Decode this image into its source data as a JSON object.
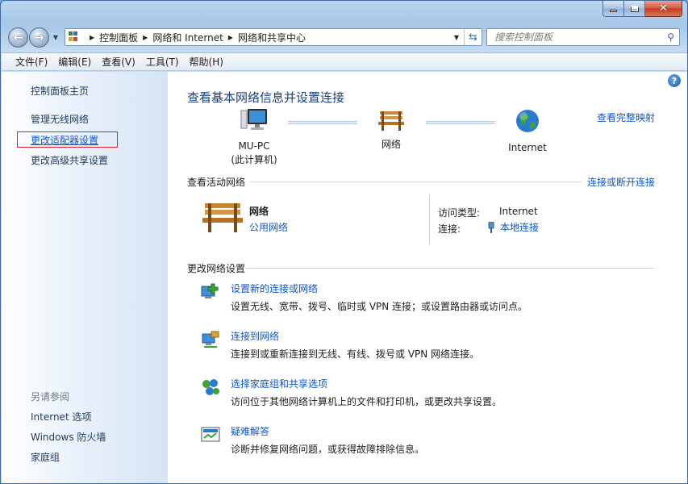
{
  "window": {
    "caption": {
      "minimize": "—",
      "maximize": "□",
      "close": "✕"
    }
  },
  "nav": {
    "back_icon": "back-arrow-icon",
    "forward_icon": "forward-arrow-icon",
    "breadcrumbs": [
      "控制面板",
      "网络和 Internet",
      "网络和共享中心"
    ],
    "search_placeholder": "搜索控制面板"
  },
  "menu": [
    "文件(F)",
    "编辑(E)",
    "查看(V)",
    "工具(T)",
    "帮助(H)"
  ],
  "sidebar": {
    "links": [
      "控制面板主页",
      "管理无线网络",
      "更改适配器设置",
      "更改高级共享设置"
    ],
    "selected_index": 2,
    "highlight_color": "#e0202a",
    "see_also_title": "另请参阅",
    "see_also": [
      "Internet 选项",
      "Windows 防火墙",
      "家庭组"
    ]
  },
  "main": {
    "title": "查看基本网络信息并设置连接",
    "full_map_link": "查看完整映射",
    "map": {
      "computer": {
        "name": "MU-PC",
        "sub": "(此计算机)"
      },
      "network": "网络",
      "internet": "Internet"
    },
    "active": {
      "header": "查看活动网络",
      "connect_link": "连接或断开连接",
      "network_name": "网络",
      "network_type": "公用网络",
      "access_type_label": "访问类型:",
      "access_type_value": "Internet",
      "connection_label": "连接:",
      "connection_value": "本地连接"
    },
    "change": {
      "header": "更改网络设置",
      "tasks": [
        {
          "title": "设置新的连接或网络",
          "desc": "设置无线、宽带、拨号、临时或 VPN 连接；或设置路由器或访问点。"
        },
        {
          "title": "连接到网络",
          "desc": "连接到或重新连接到无线、有线、拨号或 VPN 网络连接。"
        },
        {
          "title": "选择家庭组和共享选项",
          "desc": "访问位于其他网络计算机上的文件和打印机，或更改共享设置。"
        },
        {
          "title": "疑难解答",
          "desc": "诊断并修复网络问题，或获得故障排除信息。"
        }
      ]
    }
  },
  "colors": {
    "link": "#1155cc",
    "title": "#1e3f7a"
  }
}
